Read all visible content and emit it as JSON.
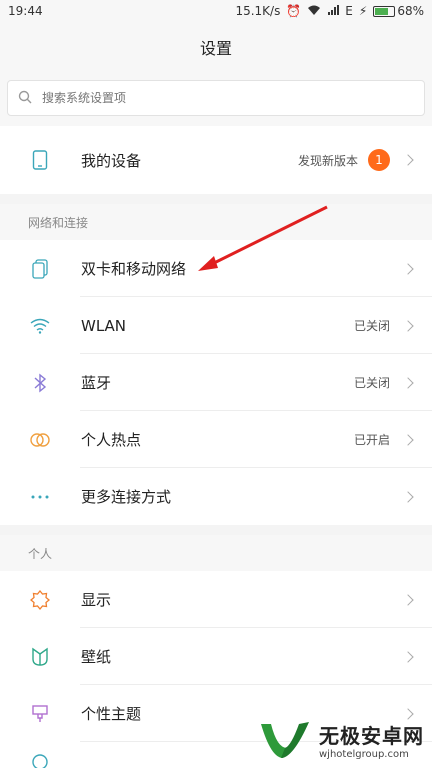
{
  "status_bar": {
    "time": "19:44",
    "speed": "15.1K/s",
    "network_type": "E",
    "battery": "68%",
    "battery_level": 0.68
  },
  "title": "设置",
  "search": {
    "placeholder": "搜索系统设置项"
  },
  "my_device": {
    "label": "我的设备",
    "value": "发现新版本",
    "badge": "1"
  },
  "network_section": {
    "header": "网络和连接",
    "items": [
      {
        "label": "双卡和移动网络",
        "value": ""
      },
      {
        "label": "WLAN",
        "value": "已关闭"
      },
      {
        "label": "蓝牙",
        "value": "已关闭"
      },
      {
        "label": "个人热点",
        "value": "已开启"
      },
      {
        "label": "更多连接方式",
        "value": ""
      }
    ]
  },
  "personal_section": {
    "header": "个人",
    "items": [
      {
        "label": "显示"
      },
      {
        "label": "壁纸"
      },
      {
        "label": "个性主题"
      }
    ]
  },
  "watermark": {
    "title": "无极安卓网",
    "url": "wjhotelgroup.com"
  },
  "colors": {
    "accent": "#ff6a1a",
    "arrow": "#e02020",
    "icon_teal": "#3aa6b9"
  }
}
